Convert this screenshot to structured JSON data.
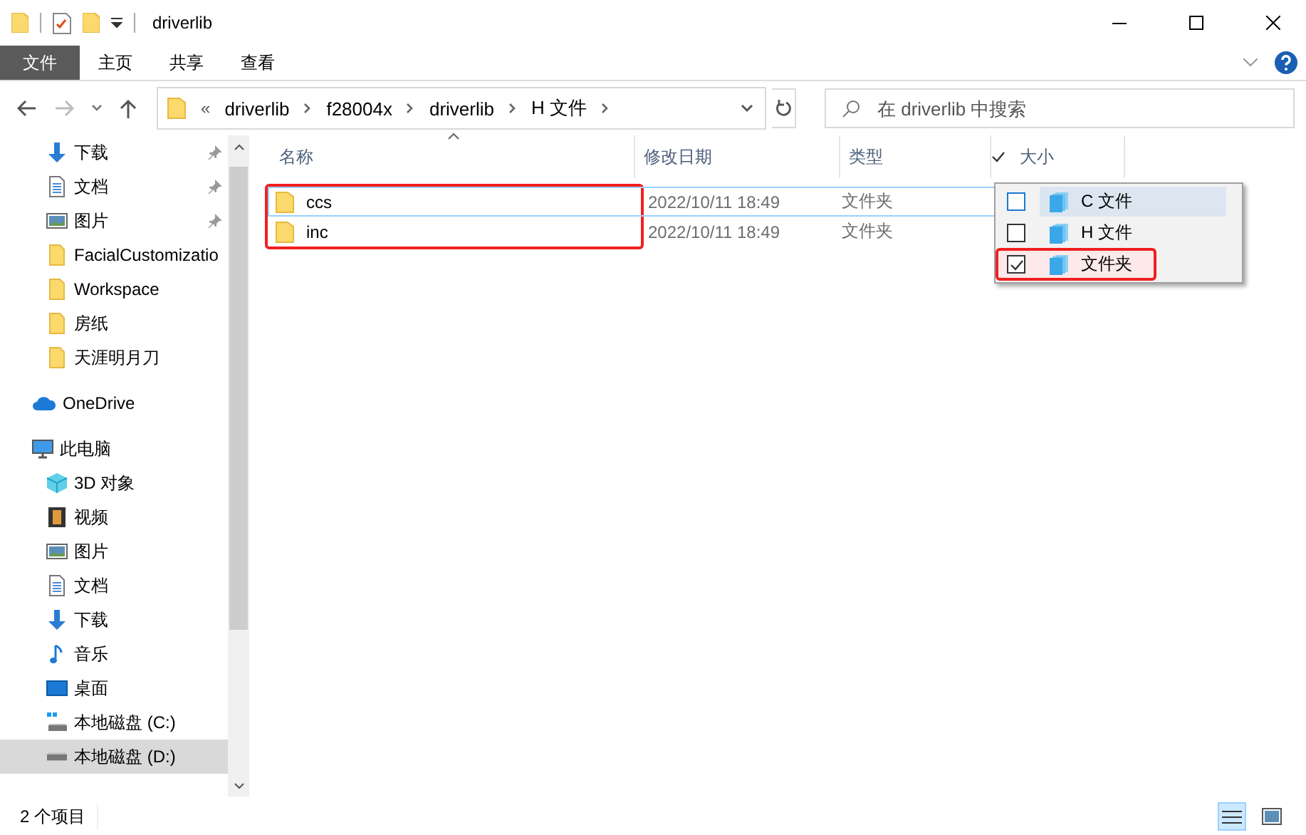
{
  "window": {
    "title": "driverlib"
  },
  "ribbon": {
    "tabs": [
      {
        "label": "文件",
        "selected": true
      },
      {
        "label": "主页",
        "selected": false
      },
      {
        "label": "共享",
        "selected": false
      },
      {
        "label": "查看",
        "selected": false
      }
    ]
  },
  "address_bar": {
    "overflow": "«",
    "crumbs": [
      "driverlib",
      "f28004x",
      "driverlib",
      "H 文件"
    ]
  },
  "search": {
    "placeholder": "在 driverlib 中搜索"
  },
  "sidebar": {
    "items": [
      {
        "label": "下载",
        "kind": "download",
        "pinned": true,
        "selected": false
      },
      {
        "label": "文档",
        "kind": "document",
        "pinned": true,
        "selected": false
      },
      {
        "label": "图片",
        "kind": "picture",
        "pinned": true,
        "selected": false
      },
      {
        "label": "FacialCustomizatio",
        "kind": "folder",
        "pinned": false,
        "selected": false
      },
      {
        "label": "Workspace",
        "kind": "folder",
        "pinned": false,
        "selected": false
      },
      {
        "label": "房纸",
        "kind": "folder",
        "pinned": false,
        "selected": false
      },
      {
        "label": "天涯明月刀",
        "kind": "folder",
        "pinned": false,
        "selected": false
      },
      {
        "label": "OneDrive",
        "kind": "cloud",
        "pinned": false,
        "selected": false
      },
      {
        "label": "此电脑",
        "kind": "computer",
        "pinned": false,
        "selected": false,
        "children": [
          {
            "label": "3D 对象",
            "kind": "cube",
            "pinned": false,
            "selected": false
          },
          {
            "label": "视频",
            "kind": "video",
            "pinned": false,
            "selected": false
          },
          {
            "label": "图片",
            "kind": "picture",
            "pinned": false,
            "selected": false
          },
          {
            "label": "文档",
            "kind": "document",
            "pinned": false,
            "selected": false
          },
          {
            "label": "下载",
            "kind": "download",
            "pinned": false,
            "selected": false
          },
          {
            "label": "音乐",
            "kind": "music",
            "pinned": false,
            "selected": false
          },
          {
            "label": "桌面",
            "kind": "desktop",
            "pinned": false,
            "selected": false
          },
          {
            "label": "本地磁盘 (C:)",
            "kind": "system-drive",
            "pinned": false,
            "selected": false
          },
          {
            "label": "本地磁盘 (D:)",
            "kind": "drive",
            "pinned": false,
            "selected": true
          }
        ]
      }
    ]
  },
  "file_list": {
    "columns": [
      {
        "label": "名称",
        "sorted": true,
        "filtered": false
      },
      {
        "label": "修改日期",
        "sorted": false,
        "filtered": false
      },
      {
        "label": "类型",
        "sorted": false,
        "filtered": false
      },
      {
        "label": "大小",
        "sorted": false,
        "filtered": true
      }
    ],
    "rows_highlighted": true,
    "rows": [
      {
        "name": "ccs",
        "modified": "2022/10/11 18:49",
        "type": "文件夹",
        "focused": true
      },
      {
        "name": "inc",
        "modified": "2022/10/11 18:49",
        "type": "文件夹",
        "focused": false
      }
    ]
  },
  "filter_menu": {
    "items": [
      {
        "label": "C 文件",
        "checked": false,
        "hovered": true,
        "highlighted": false
      },
      {
        "label": "H 文件",
        "checked": false,
        "hovered": false,
        "highlighted": false
      },
      {
        "label": "文件夹",
        "checked": true,
        "hovered": false,
        "highlighted": true
      }
    ]
  },
  "status_bar": {
    "count": "2 个项目",
    "views": [
      {
        "kind": "details",
        "selected": true
      },
      {
        "kind": "large-icons",
        "selected": false
      }
    ]
  }
}
